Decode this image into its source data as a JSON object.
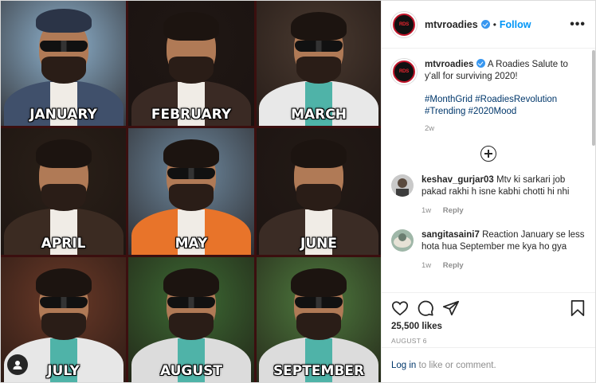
{
  "post": {
    "tiles": [
      {
        "month": "JANUARY",
        "bg": "#8fb3cf",
        "body": "#40506b",
        "shades": true,
        "cap": true
      },
      {
        "month": "FEBRUARY",
        "bg": "#1f1714",
        "body": "#3a2a24",
        "shades": false,
        "cap": false
      },
      {
        "month": "MARCH",
        "bg": "#4a3a30",
        "body": "#e8e8e8",
        "shades": true,
        "cap": false
      },
      {
        "month": "APRIL",
        "bg": "#2a2018",
        "body": "#3b2b22",
        "shades": false,
        "cap": false
      },
      {
        "month": "MAY",
        "bg": "#6f8aa0",
        "body": "#e8742a",
        "shades": true,
        "cap": false
      },
      {
        "month": "JUNE",
        "bg": "#231a16",
        "body": "#3b2c25",
        "shades": false,
        "cap": false
      },
      {
        "month": "JULY",
        "bg": "#6b3a28",
        "body": "#e7e7e7",
        "shades": true,
        "cap": false
      },
      {
        "month": "AUGUST",
        "bg": "#3d6b34",
        "body": "#dcdcdc",
        "shades": true,
        "cap": false
      },
      {
        "month": "SEPTEMBER",
        "bg": "#4e7a3e",
        "body": "#dcdcdc",
        "shades": true,
        "cap": false
      }
    ]
  },
  "header": {
    "username": "mtvroadies",
    "separator": "•",
    "follow_label": "Follow",
    "more_label": "•••"
  },
  "caption": {
    "username": "mtvroadies",
    "text": "A Roadies Salute to y'all for surviving 2020!",
    "hashtags": "#MonthGrid #RoadiesRevolution #Trending #2020Mood",
    "age": "2w"
  },
  "comments": [
    {
      "username": "keshav_gurjar03",
      "text": "Mtv ki sarkari job pakad rakhi h isne kabhi chotti hi nhi",
      "age": "1w",
      "reply_label": "Reply"
    },
    {
      "username": "sangitasaini7",
      "text": "Reaction January se less hota hua September me kya ho gya",
      "age": "1w",
      "reply_label": "Reply"
    }
  ],
  "actions": {
    "likes": "25,500 likes",
    "date": "AUGUST 6"
  },
  "login_bar": {
    "link": "Log in",
    "text": " to like or comment."
  },
  "colors": {
    "accent": "#0095f6",
    "verified": "#3897f0",
    "hashtag": "#00376b",
    "brand_red": "#c0152a"
  }
}
